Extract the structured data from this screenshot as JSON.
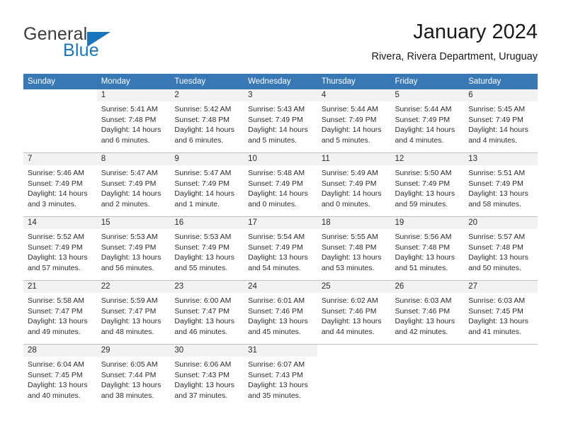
{
  "logo": {
    "word_top": "General",
    "word_bottom": "Blue",
    "triangle_icon": "triangle-icon",
    "accent_color": "#1b75bb"
  },
  "header": {
    "title": "January 2024",
    "subtitle": "Rivera, Rivera Department, Uruguay"
  },
  "theme": {
    "header_row_bg": "#3878b4",
    "header_row_text": "#ffffff",
    "daynum_band_bg": "#f2f2f2",
    "grid_line": "#bfbfbf",
    "body_text": "#2b2b2b"
  },
  "weekday_headers": [
    "Sunday",
    "Monday",
    "Tuesday",
    "Wednesday",
    "Thursday",
    "Friday",
    "Saturday"
  ],
  "weeks": [
    [
      {
        "day": "",
        "lines": []
      },
      {
        "day": "1",
        "lines": [
          "Sunrise: 5:41 AM",
          "Sunset: 7:48 PM",
          "Daylight: 14 hours",
          "and 6 minutes."
        ]
      },
      {
        "day": "2",
        "lines": [
          "Sunrise: 5:42 AM",
          "Sunset: 7:48 PM",
          "Daylight: 14 hours",
          "and 6 minutes."
        ]
      },
      {
        "day": "3",
        "lines": [
          "Sunrise: 5:43 AM",
          "Sunset: 7:49 PM",
          "Daylight: 14 hours",
          "and 5 minutes."
        ]
      },
      {
        "day": "4",
        "lines": [
          "Sunrise: 5:44 AM",
          "Sunset: 7:49 PM",
          "Daylight: 14 hours",
          "and 5 minutes."
        ]
      },
      {
        "day": "5",
        "lines": [
          "Sunrise: 5:44 AM",
          "Sunset: 7:49 PM",
          "Daylight: 14 hours",
          "and 4 minutes."
        ]
      },
      {
        "day": "6",
        "lines": [
          "Sunrise: 5:45 AM",
          "Sunset: 7:49 PM",
          "Daylight: 14 hours",
          "and 4 minutes."
        ]
      }
    ],
    [
      {
        "day": "7",
        "lines": [
          "Sunrise: 5:46 AM",
          "Sunset: 7:49 PM",
          "Daylight: 14 hours",
          "and 3 minutes."
        ]
      },
      {
        "day": "8",
        "lines": [
          "Sunrise: 5:47 AM",
          "Sunset: 7:49 PM",
          "Daylight: 14 hours",
          "and 2 minutes."
        ]
      },
      {
        "day": "9",
        "lines": [
          "Sunrise: 5:47 AM",
          "Sunset: 7:49 PM",
          "Daylight: 14 hours",
          "and 1 minute."
        ]
      },
      {
        "day": "10",
        "lines": [
          "Sunrise: 5:48 AM",
          "Sunset: 7:49 PM",
          "Daylight: 14 hours",
          "and 0 minutes."
        ]
      },
      {
        "day": "11",
        "lines": [
          "Sunrise: 5:49 AM",
          "Sunset: 7:49 PM",
          "Daylight: 14 hours",
          "and 0 minutes."
        ]
      },
      {
        "day": "12",
        "lines": [
          "Sunrise: 5:50 AM",
          "Sunset: 7:49 PM",
          "Daylight: 13 hours",
          "and 59 minutes."
        ]
      },
      {
        "day": "13",
        "lines": [
          "Sunrise: 5:51 AM",
          "Sunset: 7:49 PM",
          "Daylight: 13 hours",
          "and 58 minutes."
        ]
      }
    ],
    [
      {
        "day": "14",
        "lines": [
          "Sunrise: 5:52 AM",
          "Sunset: 7:49 PM",
          "Daylight: 13 hours",
          "and 57 minutes."
        ]
      },
      {
        "day": "15",
        "lines": [
          "Sunrise: 5:53 AM",
          "Sunset: 7:49 PM",
          "Daylight: 13 hours",
          "and 56 minutes."
        ]
      },
      {
        "day": "16",
        "lines": [
          "Sunrise: 5:53 AM",
          "Sunset: 7:49 PM",
          "Daylight: 13 hours",
          "and 55 minutes."
        ]
      },
      {
        "day": "17",
        "lines": [
          "Sunrise: 5:54 AM",
          "Sunset: 7:49 PM",
          "Daylight: 13 hours",
          "and 54 minutes."
        ]
      },
      {
        "day": "18",
        "lines": [
          "Sunrise: 5:55 AM",
          "Sunset: 7:48 PM",
          "Daylight: 13 hours",
          "and 53 minutes."
        ]
      },
      {
        "day": "19",
        "lines": [
          "Sunrise: 5:56 AM",
          "Sunset: 7:48 PM",
          "Daylight: 13 hours",
          "and 51 minutes."
        ]
      },
      {
        "day": "20",
        "lines": [
          "Sunrise: 5:57 AM",
          "Sunset: 7:48 PM",
          "Daylight: 13 hours",
          "and 50 minutes."
        ]
      }
    ],
    [
      {
        "day": "21",
        "lines": [
          "Sunrise: 5:58 AM",
          "Sunset: 7:47 PM",
          "Daylight: 13 hours",
          "and 49 minutes."
        ]
      },
      {
        "day": "22",
        "lines": [
          "Sunrise: 5:59 AM",
          "Sunset: 7:47 PM",
          "Daylight: 13 hours",
          "and 48 minutes."
        ]
      },
      {
        "day": "23",
        "lines": [
          "Sunrise: 6:00 AM",
          "Sunset: 7:47 PM",
          "Daylight: 13 hours",
          "and 46 minutes."
        ]
      },
      {
        "day": "24",
        "lines": [
          "Sunrise: 6:01 AM",
          "Sunset: 7:46 PM",
          "Daylight: 13 hours",
          "and 45 minutes."
        ]
      },
      {
        "day": "25",
        "lines": [
          "Sunrise: 6:02 AM",
          "Sunset: 7:46 PM",
          "Daylight: 13 hours",
          "and 44 minutes."
        ]
      },
      {
        "day": "26",
        "lines": [
          "Sunrise: 6:03 AM",
          "Sunset: 7:46 PM",
          "Daylight: 13 hours",
          "and 42 minutes."
        ]
      },
      {
        "day": "27",
        "lines": [
          "Sunrise: 6:03 AM",
          "Sunset: 7:45 PM",
          "Daylight: 13 hours",
          "and 41 minutes."
        ]
      }
    ],
    [
      {
        "day": "28",
        "lines": [
          "Sunrise: 6:04 AM",
          "Sunset: 7:45 PM",
          "Daylight: 13 hours",
          "and 40 minutes."
        ]
      },
      {
        "day": "29",
        "lines": [
          "Sunrise: 6:05 AM",
          "Sunset: 7:44 PM",
          "Daylight: 13 hours",
          "and 38 minutes."
        ]
      },
      {
        "day": "30",
        "lines": [
          "Sunrise: 6:06 AM",
          "Sunset: 7:43 PM",
          "Daylight: 13 hours",
          "and 37 minutes."
        ]
      },
      {
        "day": "31",
        "lines": [
          "Sunrise: 6:07 AM",
          "Sunset: 7:43 PM",
          "Daylight: 13 hours",
          "and 35 minutes."
        ]
      },
      {
        "day": "",
        "lines": []
      },
      {
        "day": "",
        "lines": []
      },
      {
        "day": "",
        "lines": []
      }
    ]
  ]
}
